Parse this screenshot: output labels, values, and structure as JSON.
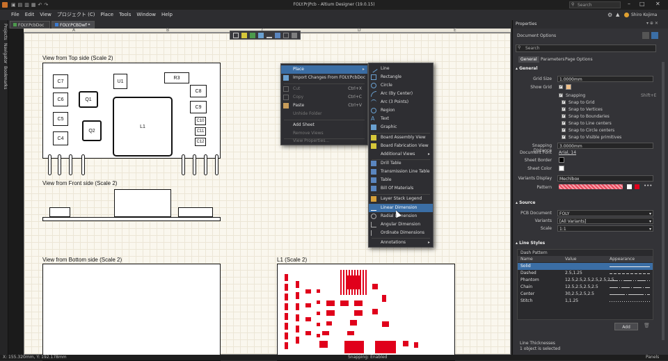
{
  "window": {
    "title": "FOLY.PrjPcb - Altium Designer (19.0.15)",
    "search_placeholder": "Search",
    "user": "Shiro Kojima"
  },
  "menubar": [
    "File",
    "Edit",
    "View",
    "プロジェクト (C)",
    "Place",
    "Tools",
    "Window",
    "Help"
  ],
  "doc_tabs": [
    "FOLY.PcbDoc",
    "FOLY.PCBDwf *"
  ],
  "left_tabs": [
    "Projects",
    "Navigator",
    "Bookmarks"
  ],
  "rulers": {
    "columns": [
      "A",
      "B",
      "C",
      "D",
      "E"
    ],
    "rows": [
      "1",
      "2",
      "3",
      "4"
    ]
  },
  "drawing": {
    "top_view_caption": "View from Top side (Scale 2)",
    "front_view_caption": "View from Front side (Scale 2)",
    "bottom_view_caption": "View from Bottom side (Scale 2)",
    "l1_caption": "L1 (Scale 2)",
    "components": [
      "C7",
      "C6",
      "C5",
      "C4",
      "Q1",
      "U1",
      "R3",
      "C8",
      "C9",
      "Q2",
      "L1",
      "C10",
      "C11",
      "C12"
    ]
  },
  "context_menu": {
    "items": [
      {
        "label": "Place",
        "shortcut": "",
        "state": "highlight"
      },
      {
        "label": "Import Changes From FOLY.PcbDoc",
        "shortcut": "",
        "state": "normal"
      },
      {
        "label": "Cut",
        "shortcut": "Ctrl+X",
        "state": "disabled"
      },
      {
        "label": "Copy",
        "shortcut": "Ctrl+C",
        "state": "disabled"
      },
      {
        "label": "Paste",
        "shortcut": "Ctrl+V",
        "state": "normal"
      },
      {
        "label": "Unhide Folder",
        "shortcut": "",
        "state": "disabled"
      },
      {
        "label": "Add Sheet",
        "shortcut": "",
        "state": "normal"
      },
      {
        "label": "Remove Views",
        "shortcut": "",
        "state": "disabled"
      },
      {
        "label": "View Properties...",
        "shortcut": "",
        "state": "disabled"
      }
    ]
  },
  "place_submenu": {
    "items": [
      "Line",
      "Rectangle",
      "Circle",
      "Arc (By Center)",
      "Arc (3 Points)",
      "Region",
      "Text",
      "Graphic",
      "Board Assembly View",
      "Board Fabrication View",
      "Additional Views",
      "Drill Table",
      "Transmission Line Table",
      "Table",
      "Bill Of Materials",
      "Layer Stack Legend",
      "Linear Dimension",
      "Radial Dimension",
      "Angular Dimension",
      "Ordinate Dimensions",
      "Annotations"
    ],
    "highlighted": "Linear Dimension"
  },
  "properties": {
    "title": "Properties",
    "subtitle": "Document Options",
    "search_placeholder": "Search",
    "tabs": [
      "General",
      "Parameters",
      "Page Options"
    ],
    "general_header": "General",
    "grid_size_label": "Grid Size",
    "grid_size": "1.0000mm",
    "show_grid_label": "Show Grid",
    "snapping_label": "Snapping",
    "snapping_shortcut": "Shift+E",
    "snap_options": [
      "Snap to Grid",
      "Snap to Vertices",
      "Snap to Boundaries",
      "Snap to Line centers",
      "Snap to Circle centers",
      "Snap to Visible primitives"
    ],
    "snapping_distance_label": "Snapping Distance",
    "snapping_distance": "3.0000mm",
    "document_font_label": "Document Font",
    "document_font": "Arial, 14",
    "sheet_border_label": "Sheet Border",
    "sheet_color_label": "Sheet Color",
    "variants_display_label": "Variants Display",
    "variants_display": "Mechlbox",
    "pattern_label": "Pattern",
    "source_header": "Source",
    "pcb_document_label": "PCB Document",
    "pcb_document": "FOLY",
    "variants_label": "Variants",
    "variants": "[All Variants]",
    "scale_label": "Scale",
    "scale": "1:1",
    "line_styles_header": "Line Styles",
    "dash_pattern_label": "Dash Pattern",
    "columns": [
      "Name",
      "Value",
      "Appearance"
    ],
    "line_styles": [
      {
        "name": "Solid",
        "value": ""
      },
      {
        "name": "Dashed",
        "value": "2.5,1.25"
      },
      {
        "name": "Phantom",
        "value": "12.5,2.5,2.5,2.5,2.5,2.5"
      },
      {
        "name": "Chain",
        "value": "12.5,2.5,2.5,2.5"
      },
      {
        "name": "Center",
        "value": "30,2.5,2.5,2.5"
      },
      {
        "name": "Stitch",
        "value": "1,1.25"
      }
    ],
    "add_button": "Add",
    "line_thickness_label": "Line Thicknesses",
    "selection_status": "1 object is selected"
  },
  "statusbar": {
    "coords": "X: 155.320mm, Y: 192.178mm",
    "snapping": "Snapping: Enabled",
    "panels": "Panels"
  },
  "colors": {
    "accent": "#3b6ea5",
    "sheet": "#faf7ee",
    "copper": "#e0001b",
    "pattern": "#e8495d"
  }
}
